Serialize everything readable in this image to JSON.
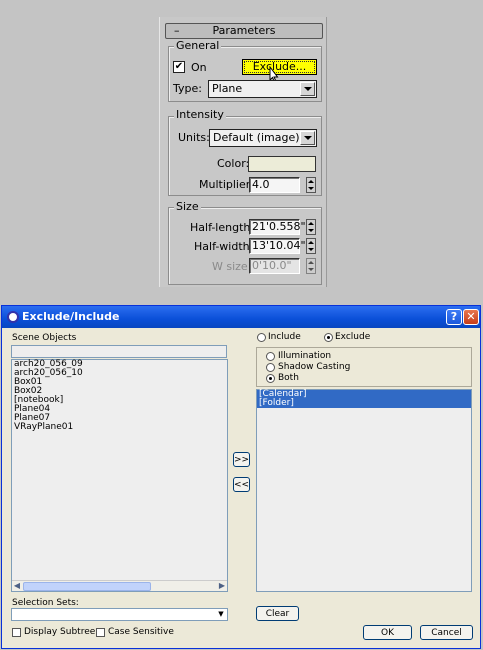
{
  "rollout": {
    "title": "Parameters",
    "collapse_symbol": "–",
    "general": {
      "label": "General",
      "on_label": "On",
      "on_checked": true,
      "exclude_label": "Exclude...",
      "type_label": "Type:",
      "type_value": "Plane"
    },
    "intensity": {
      "label": "Intensity",
      "units_label": "Units:",
      "units_value": "Default (image)",
      "color_label": "Color:",
      "color_value": "#ececd8",
      "multiplier_label": "Multiplier:",
      "multiplier_value": "4.0"
    },
    "size": {
      "label": "Size",
      "half_length_label": "Half-length:",
      "half_length_value": "21'0.558\"",
      "half_width_label": "Half-width:",
      "half_width_value": "13'10.04\"",
      "w_size_label": "W size",
      "w_size_value": "0'10.0\""
    }
  },
  "dialog": {
    "title": "Exclude/Include",
    "help_symbol": "?",
    "close_symbol": "✕",
    "scene_objects_label": "Scene Objects",
    "search_value": "",
    "scene_objects": [
      "arch20_056_09",
      "arch20_056_10",
      "Box01",
      "Box02",
      "[notebook]",
      "Plane04",
      "Plane07",
      "VRayPlane01"
    ],
    "mode_include_label": "Include",
    "mode_exclude_label": "Exclude",
    "mode_selected": "Exclude",
    "illumination_label": "Illumination",
    "shadow_casting_label": "Shadow Casting",
    "both_label": "Both",
    "effect_selected": "Both",
    "excluded_items": [
      "[Calendar]",
      "[Folder]"
    ],
    "add_button": ">>",
    "remove_button": "<<",
    "selection_sets_label": "Selection Sets:",
    "selection_sets_value": "",
    "clear_button": "Clear",
    "display_subtree_label": "Display Subtree",
    "case_sensitive_label": "Case Sensitive",
    "ok_button": "OK",
    "cancel_button": "Cancel"
  },
  "colors": {
    "exclude_highlight": "#ffff00",
    "selection": "#316ac5",
    "titlebar": "#0a4fd8"
  }
}
